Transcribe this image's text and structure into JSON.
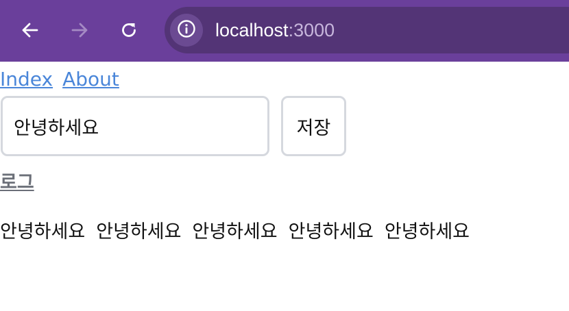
{
  "browser": {
    "url_host": "localhost",
    "url_port": ":3000",
    "icons": {
      "back": "arrow-left-icon",
      "forward": "arrow-right-icon",
      "reload": "reload-icon",
      "site_info": "info-icon"
    },
    "colors": {
      "toolbar": "#6a3f9b",
      "omnibox": "#533476"
    }
  },
  "nav": {
    "links": [
      {
        "label": "Index"
      },
      {
        "label": "About"
      }
    ]
  },
  "form": {
    "input_value": "안녕하세요",
    "save_label": "저장"
  },
  "log": {
    "heading": "로그",
    "entries": [
      "안녕하세요",
      "안녕하세요",
      "안녕하세요",
      "안녕하세요",
      "안녕하세요"
    ]
  }
}
